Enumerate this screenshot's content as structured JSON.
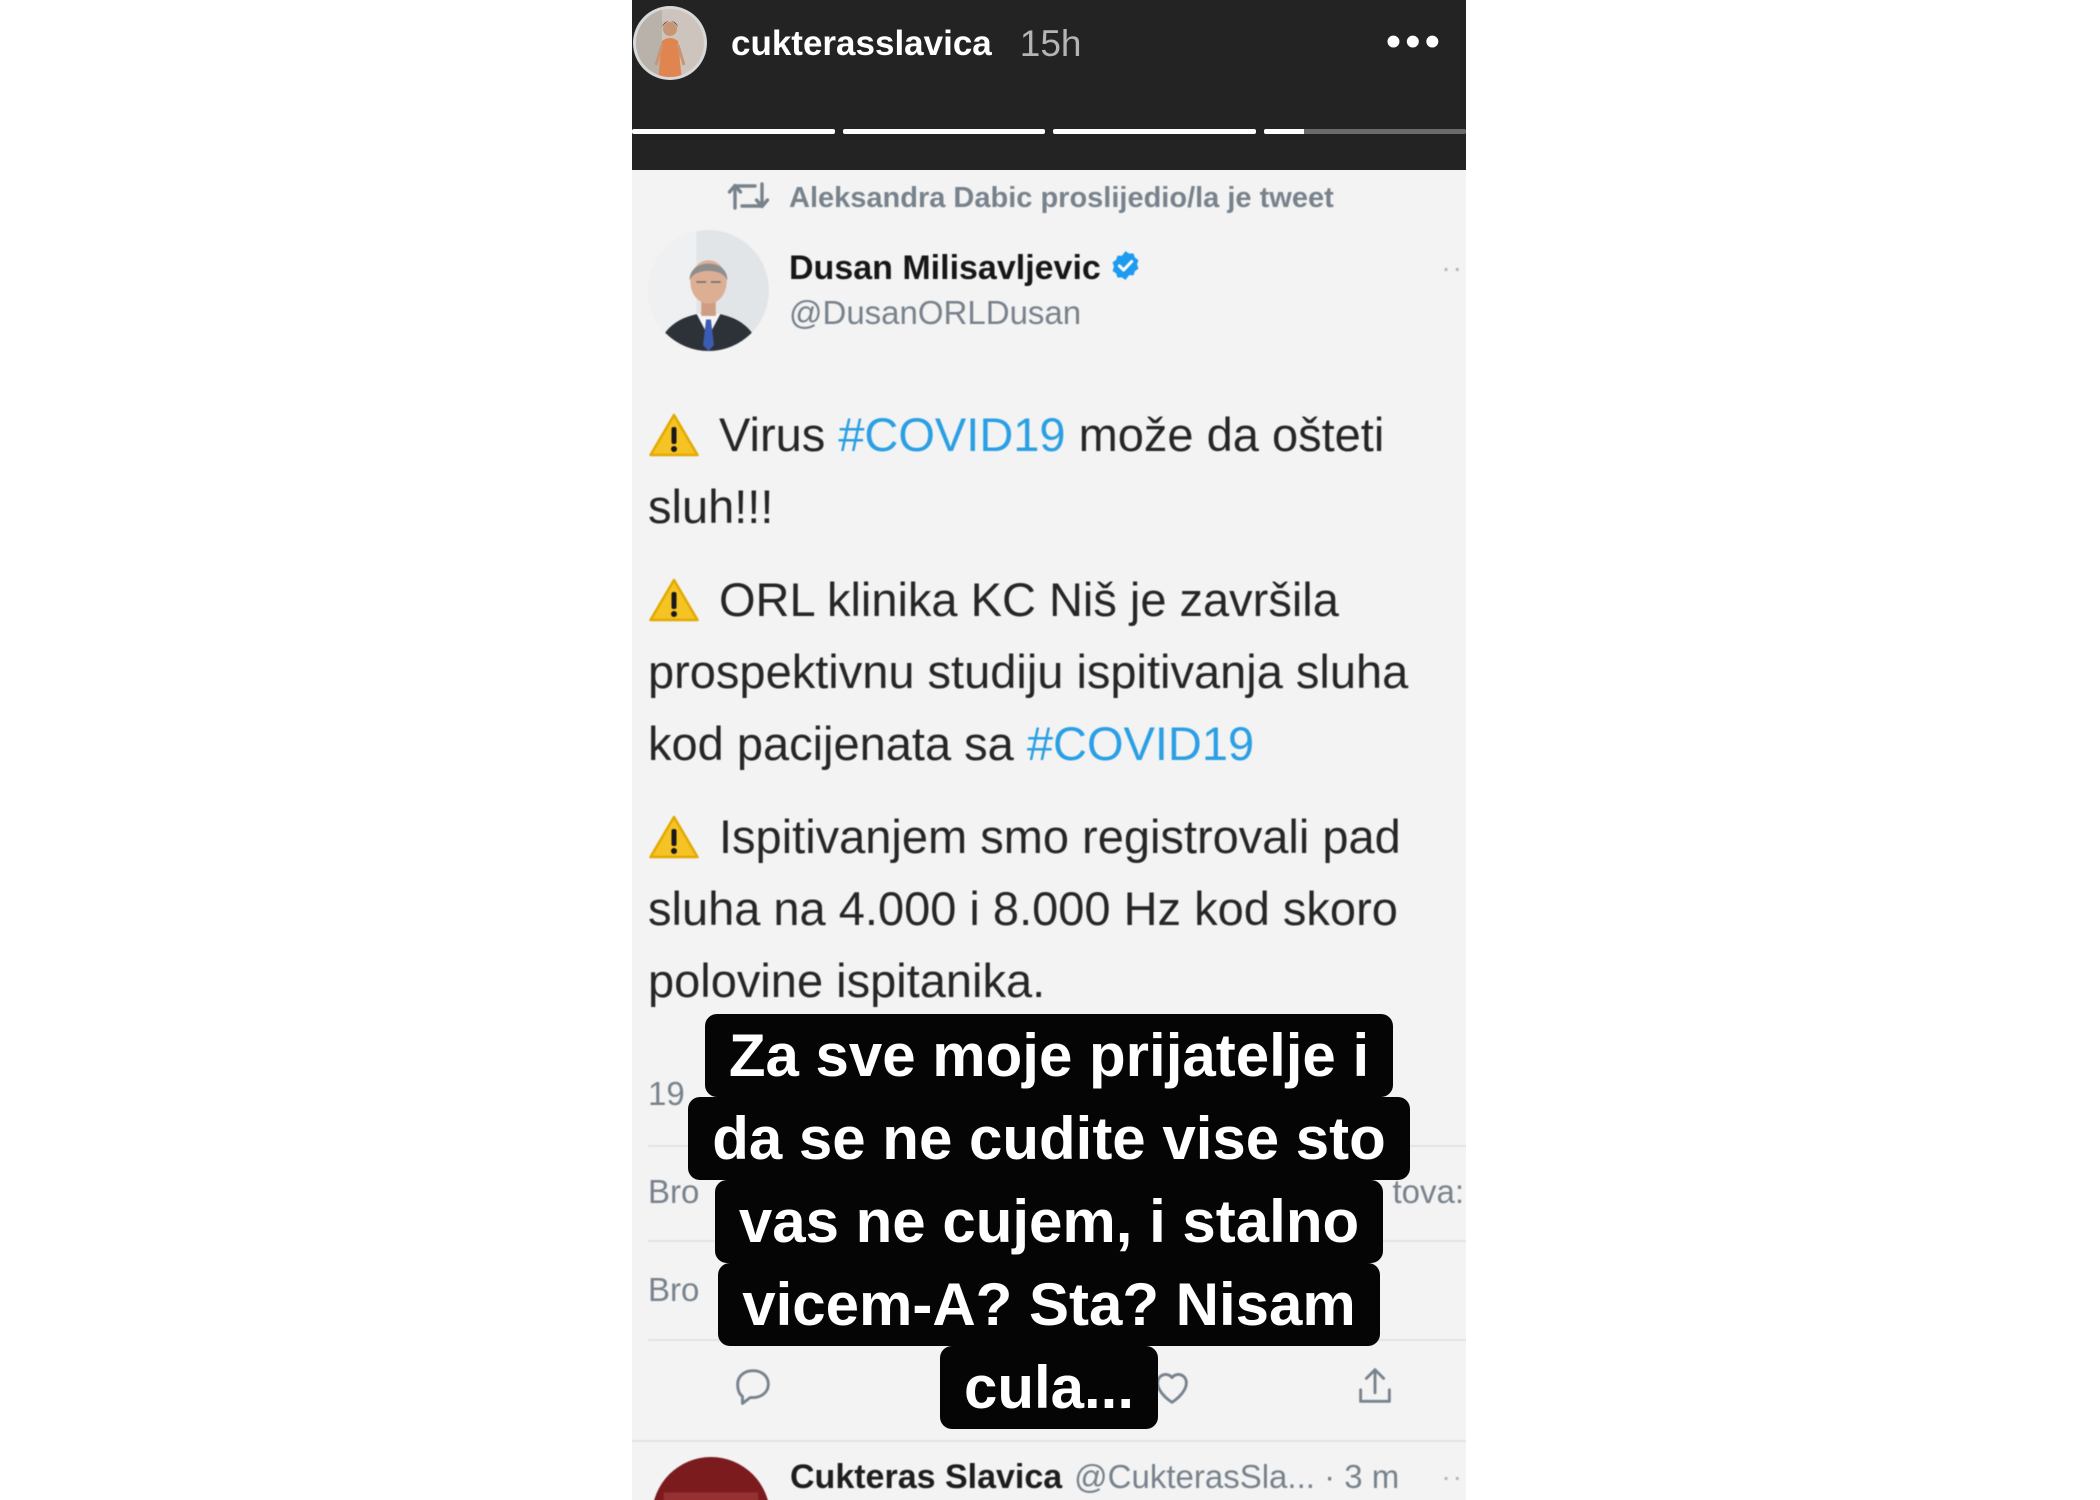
{
  "colors": {
    "page_bg": "#ffffff",
    "header_bg": "#232323",
    "tweet_bg": "#f3f3f3",
    "text": "#262626",
    "secondary": "#78828c",
    "hashtag": "#2a9fe4",
    "verified": "#1d9bf0",
    "overlay_bg": "#050505",
    "progress_fill": "#ffffff",
    "progress_track": "#6b6b6b",
    "divider": "#e2e2e2"
  },
  "story_header": {
    "username": "cukterasslavica",
    "time_ago": "15h",
    "more_label": "•••",
    "progress_segments": [
      1,
      1,
      1,
      0.2
    ]
  },
  "tweet": {
    "retweet_icon": "retweet-icon",
    "retweet_label": "Aleksandra Dabic proslijedio/la je tweet",
    "author_name": "Dusan Milisavljevic",
    "verified_icon": "verified-badge-icon",
    "author_handle": "@DusanORLDusan",
    "more_label": "··",
    "paragraphs": [
      {
        "icon": "warning-icon",
        "lines": [
          [
            {
              "text": "Virus "
            },
            {
              "text": "#COVID19",
              "hashtag": true
            },
            {
              "text": " može da ošteti"
            }
          ],
          [
            {
              "text": "sluh!!!"
            }
          ]
        ]
      },
      {
        "icon": "warning-icon",
        "lines": [
          [
            {
              "text": "ORL klinika KC Niš je završila"
            }
          ],
          [
            {
              "text": "prospektivnu studiju ispitivanja sluha"
            }
          ],
          [
            {
              "text": "kod pacijenata sa "
            },
            {
              "text": "#COVID19",
              "hashtag": true
            }
          ]
        ]
      },
      {
        "icon": "warning-icon",
        "lines": [
          [
            {
              "text": "Ispitivanjem smo registrovali pad"
            }
          ],
          [
            {
              "text": "sluha na 4.000 i 8.000 Hz kod skoro"
            }
          ],
          [
            {
              "text": "polovine ispitanika."
            }
          ]
        ]
      }
    ],
    "stats_partial": {
      "date_fragment": "19",
      "retweets_fragment": "Bro",
      "quote_tweets_suffix": "tova:",
      "likes_fragment": "Bro"
    },
    "actions": [
      {
        "icon": "reply-icon"
      },
      {
        "icon": "heart-icon"
      },
      {
        "icon": "share-icon"
      }
    ]
  },
  "story_text_overlay": {
    "lines": [
      "Za sve moje prijatelje i",
      "da se ne cudite vise sto",
      "vas ne cujem, i stalno",
      "vicem-A? Sta? Nisam",
      "cula..."
    ]
  },
  "next_tweet": {
    "author_name": "Cukteras Slavica",
    "handle_time": "@CukterasSla... · 3 m",
    "more_label": "··"
  }
}
